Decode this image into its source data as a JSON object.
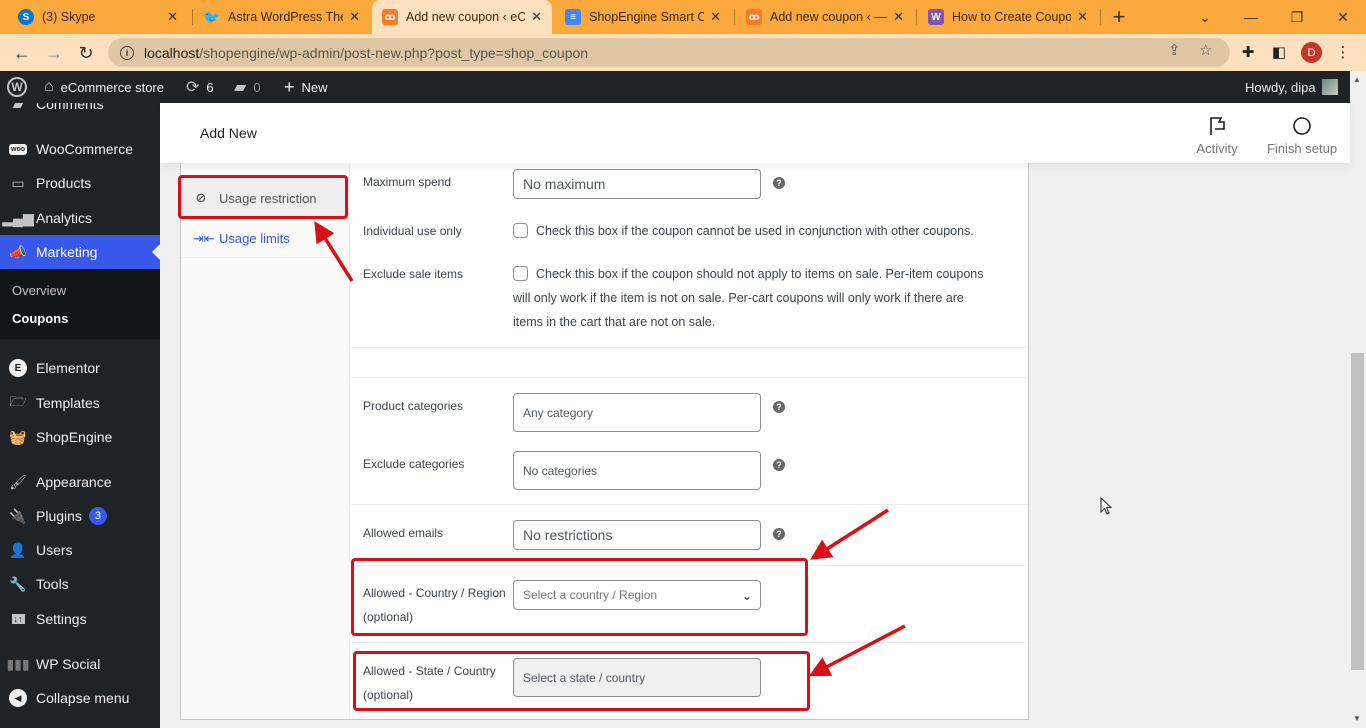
{
  "browser": {
    "tabs": [
      {
        "title": "(3) Skype",
        "icon": "skype-icon",
        "color": "#0078d4",
        "active": false
      },
      {
        "title": "Astra WordPress Them",
        "icon": "twitter-icon",
        "color": "#1d9bf0",
        "active": false
      },
      {
        "title": "Add new coupon ‹ eC",
        "icon": "xampp-icon",
        "color": "#fb7a24",
        "active": true
      },
      {
        "title": "ShopEngine Smart Co",
        "icon": "google-docs-icon",
        "color": "#4285f4",
        "active": false
      },
      {
        "title": "Add new coupon ‹ —",
        "icon": "xampp-icon",
        "color": "#fb7a24",
        "active": false
      },
      {
        "title": "How to Create Coupo",
        "icon": "woo-icon",
        "color": "#7f54b3",
        "active": false
      }
    ],
    "new_tab_label": "+",
    "url_host": "localhost",
    "url_path": "/shopengine/wp-admin/post-new.php?post_type=shop_coupon",
    "profile_initial": "D"
  },
  "adminbar": {
    "site_name": "eCommerce store",
    "updates_count": "6",
    "comments_count": "0",
    "new_label": "New",
    "howdy": "Howdy, dipa"
  },
  "sidebar": {
    "items": [
      {
        "label": "Comments",
        "icon": "comments-icon"
      },
      {
        "label": "WooCommerce",
        "icon": "woocommerce-icon"
      },
      {
        "label": "Products",
        "icon": "products-icon"
      },
      {
        "label": "Analytics",
        "icon": "analytics-icon"
      },
      {
        "label": "Marketing",
        "icon": "megaphone-icon",
        "current": true
      },
      {
        "label": "Elementor",
        "icon": "elementor-icon"
      },
      {
        "label": "Templates",
        "icon": "folder-icon"
      },
      {
        "label": "ShopEngine",
        "icon": "basket-icon"
      },
      {
        "label": "Appearance",
        "icon": "paintbrush-icon"
      },
      {
        "label": "Plugins",
        "icon": "plugin-icon",
        "badge": "3"
      },
      {
        "label": "Users",
        "icon": "users-icon"
      },
      {
        "label": "Tools",
        "icon": "wrench-icon"
      },
      {
        "label": "Settings",
        "icon": "settings-icon"
      },
      {
        "label": "WP Social",
        "icon": "wp-social-icon"
      },
      {
        "label": "Collapse menu",
        "icon": "collapse-icon"
      }
    ],
    "submenu": [
      {
        "label": "Overview"
      },
      {
        "label": "Coupons",
        "active": true
      }
    ]
  },
  "wc_header": {
    "title": "Add New",
    "activity_label": "Activity",
    "finish_setup_label": "Finish setup"
  },
  "coupon_tabs": [
    {
      "label": "Usage restriction",
      "icon": "restriction-icon",
      "active": true
    },
    {
      "label": "Usage limits",
      "icon": "limits-icon",
      "active": false
    }
  ],
  "fields": {
    "maximum_spend": {
      "label": "Maximum spend",
      "placeholder": "No maximum"
    },
    "individual_use": {
      "label": "Individual use only",
      "description": "Check this box if the coupon cannot be used in conjunction with other coupons.",
      "checked": false
    },
    "exclude_sale": {
      "label": "Exclude sale items",
      "description_line1": "Check this box if the coupon should not apply to items on sale. Per-item coupons",
      "description_line2": "will only work if the item is not on sale. Per-cart coupons will only work if there are",
      "description_line3": "items in the cart that are not on sale.",
      "checked": false
    },
    "product_categories": {
      "label": "Product categories",
      "placeholder": "Any category"
    },
    "exclude_categories": {
      "label": "Exclude categories",
      "placeholder": "No categories"
    },
    "allowed_emails": {
      "label": "Allowed emails",
      "placeholder": "No restrictions"
    },
    "allowed_country": {
      "label_line1": "Allowed - Country / Region",
      "label_line2": "(optional)",
      "placeholder": "Select a country / Region"
    },
    "allowed_state": {
      "label_line1": "Allowed - State / Country",
      "label_line2": "(optional)",
      "placeholder": "Select a state / country"
    },
    "help_glyph": "?"
  },
  "annotation_color": "#d90f18"
}
